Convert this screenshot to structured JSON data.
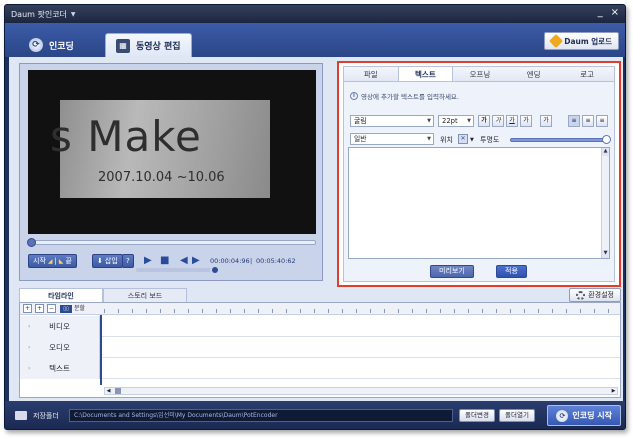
{
  "window": {
    "title": "Daum 팟인코더"
  },
  "main_tabs": [
    {
      "label": "인코딩"
    },
    {
      "label": "동영상 편집"
    }
  ],
  "upload_button": "Daum 업로드",
  "preview": {
    "video_text_big": "s Make",
    "video_text_date": "2007.10.04 ~10.06"
  },
  "controls": {
    "start_label": "시작",
    "end_label": "끝",
    "insert_label": "삽입",
    "help_label": "?",
    "current_time": "00:00:04:96",
    "total_time": "00:05:40:62",
    "separator": "|"
  },
  "edit": {
    "tabs": [
      "파일",
      "텍스트",
      "오프닝",
      "엔딩",
      "로고"
    ],
    "active_tab": "텍스트",
    "hint": "영상에 추가할 텍스트를 입력하세요.",
    "font_value": "굴림",
    "size_value": "22pt",
    "format_buttons": [
      "가",
      "가",
      "가",
      "가",
      "가",
      "≡",
      "≡",
      "≡"
    ],
    "style_value": "일반",
    "position_label": "위치",
    "opacity_label": "투명도",
    "preview_button": "미리보기",
    "apply_button": "적용"
  },
  "timeline": {
    "tabs": [
      "타임라인",
      "스토리 보드"
    ],
    "settings_button": "환경설정",
    "split_label": "분할",
    "tracks": [
      "비디오",
      "오디오",
      "텍스트"
    ]
  },
  "bottom": {
    "folder_label": "저장폴더",
    "path": "C:\\Documents and Settings\\임선미\\My Documents\\Daum\\PotEncoder",
    "change_folder_button": "폴더변경",
    "open_folder_button": "폴더열기",
    "start_encoding_button": "인코딩 시작"
  }
}
